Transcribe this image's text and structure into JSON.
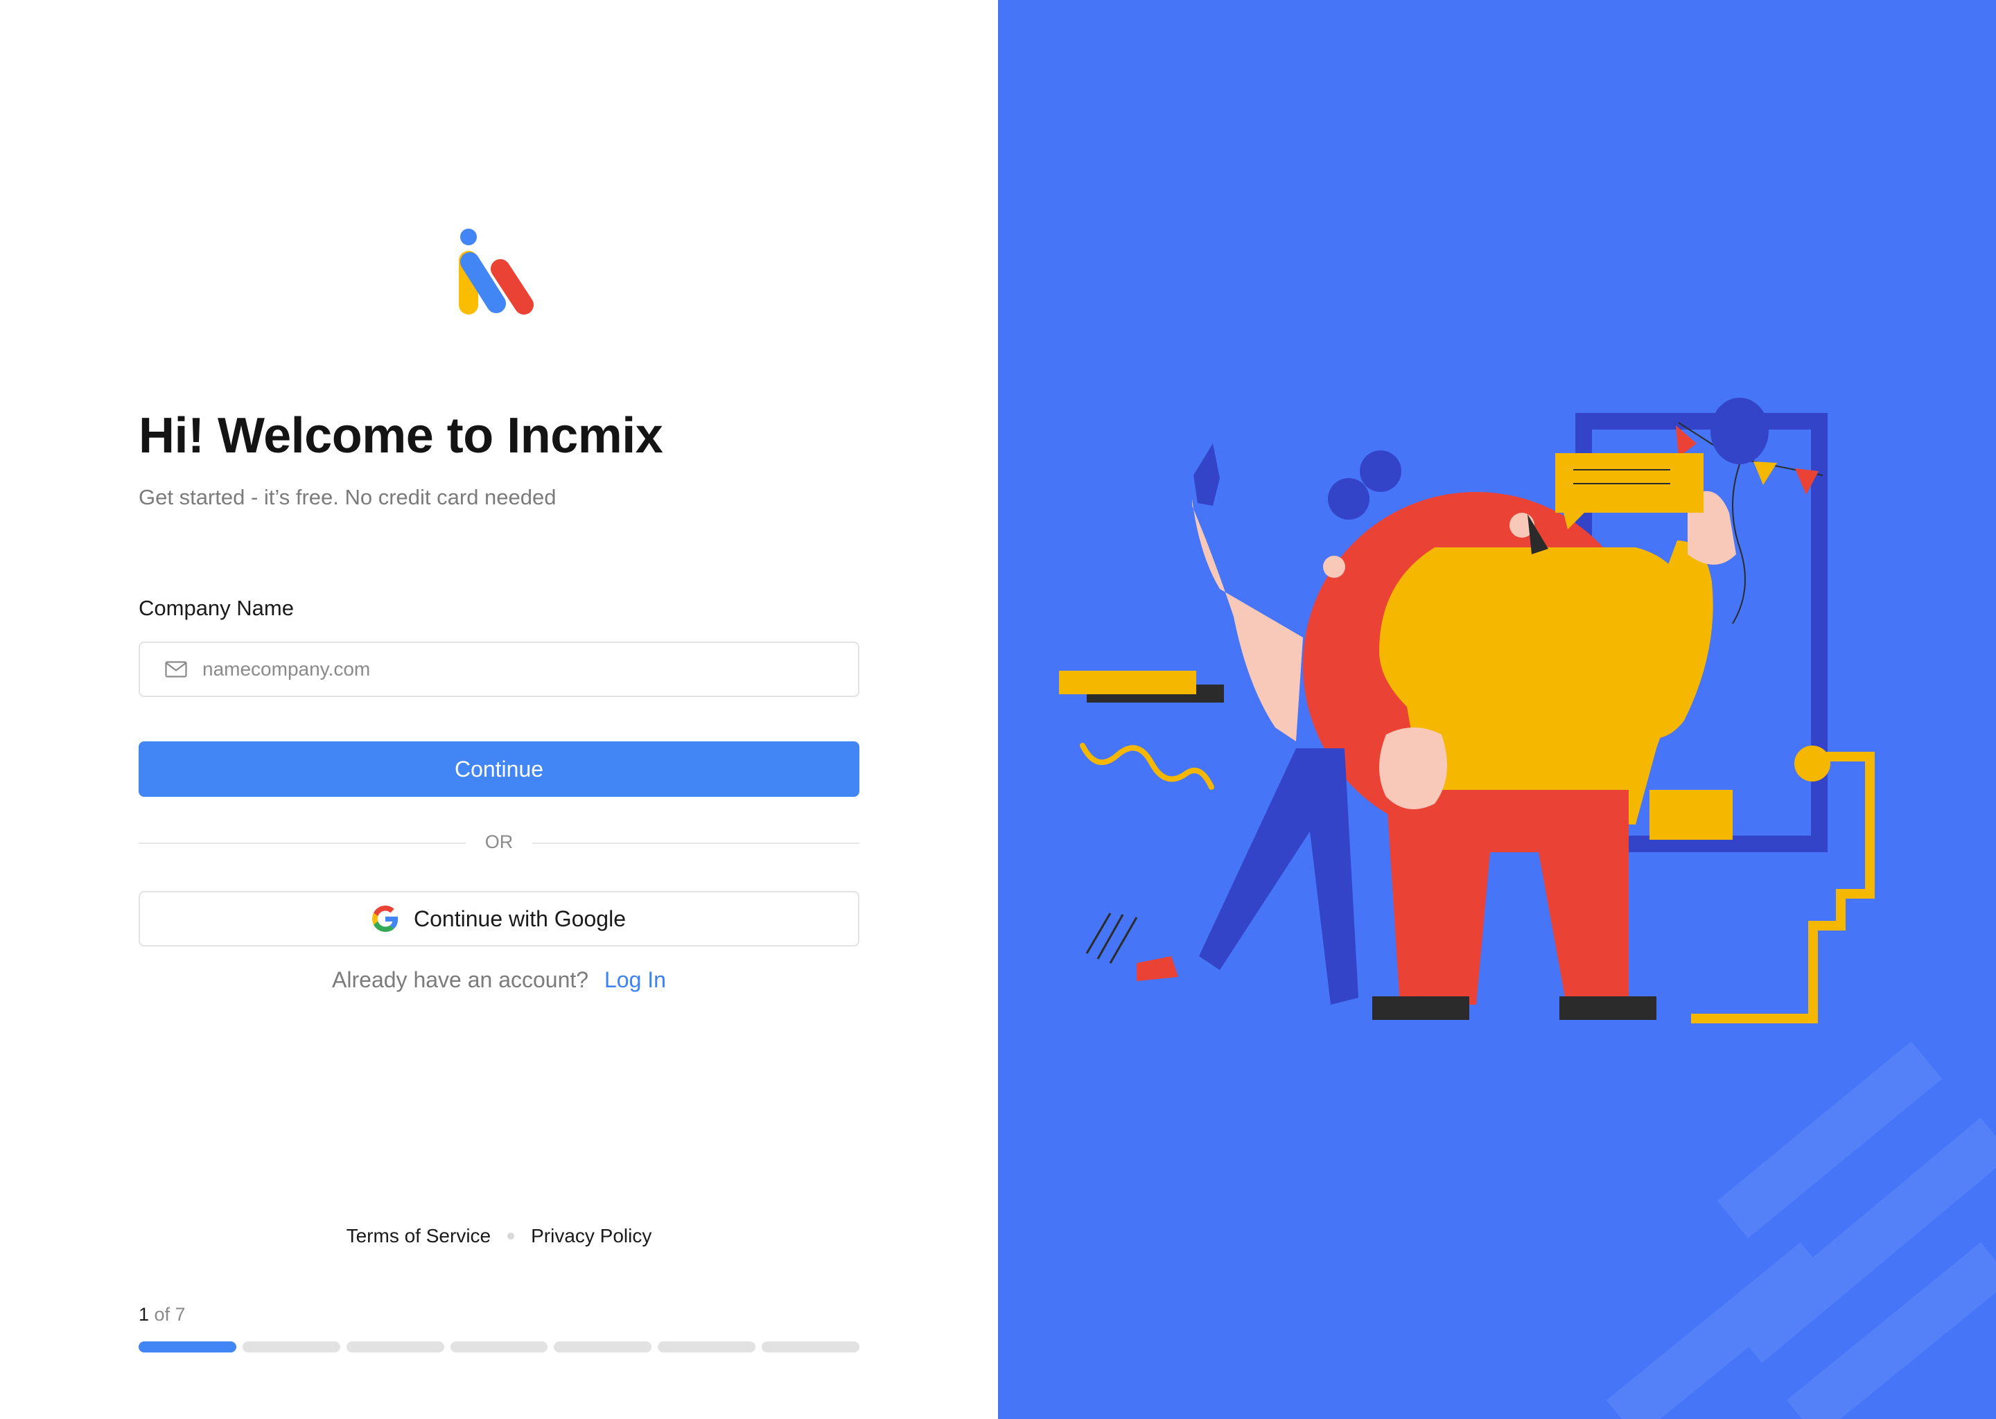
{
  "brand": {
    "logo_alt": "Incmix"
  },
  "header": {
    "title": "Hi! Welcome to Incmix",
    "subtitle": "Get started - it’s free. No credit card needed"
  },
  "form": {
    "company_label": "Company Name",
    "company_placeholder": "namecompany.com",
    "company_value": "",
    "continue_label": "Continue",
    "or_label": "OR",
    "google_label": "Continue with Google",
    "login_prompt": "Already have an account?",
    "login_link": "Log In"
  },
  "footer": {
    "terms": "Terms of Service",
    "privacy": "Privacy Policy"
  },
  "progress": {
    "current_step": "1",
    "of_total": " of 7",
    "current": 1,
    "total": 7
  },
  "colors": {
    "accent": "#4285f4",
    "illustration_bg": "#4676f7"
  },
  "icons": {
    "input": "mail-icon",
    "google": "google-g-icon"
  }
}
